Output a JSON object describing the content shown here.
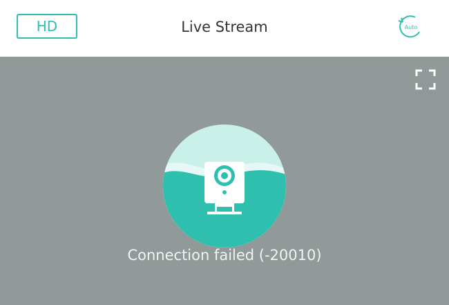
{
  "header": {
    "quality_label": "HD",
    "title": "Live Stream",
    "auto_icon": "auto-rotate-icon",
    "auto_icon_text": "Auto"
  },
  "video": {
    "fullscreen_icon": "fullscreen-icon",
    "camera_icon": "camera-icon",
    "status_message": "Connection failed (-20010)"
  },
  "colors": {
    "accent": "#2ebfae",
    "circle_light": "#c9f1ea",
    "circle_dark": "#2ebfae",
    "video_bg": "#919a99"
  }
}
